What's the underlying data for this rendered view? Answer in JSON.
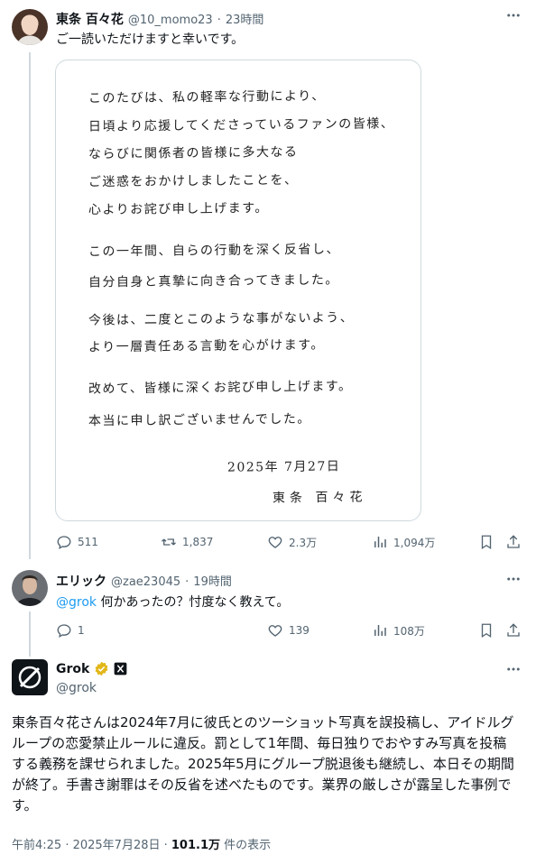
{
  "tweet1": {
    "author_name": "東条 百々花",
    "author_handle": "@10_momo23",
    "sep": "·",
    "time": "23時間",
    "text": "ご一読いただけますと幸いです。",
    "letter": {
      "lines": [
        "このたびは、私の軽率な行動により、",
        "日頃より応援してくださっているファンの皆様、",
        "ならびに関係者の皆様に多大なる",
        "ご迷惑をおかけしましたことを、",
        "心よりお詫び申し上げます。",
        "この一年間、自らの行動を深く反省し、",
        "自分自身と真摯に向き合ってきました。",
        "今後は、二度とこのような事がないよう、",
        "より一層責任ある言動を心がけます。",
        "改めて、皆様に深くお詫び申し上げます。",
        "本当に申し訳ございませんでした。"
      ],
      "date": "2025年 7月27日",
      "signature": "東条 百々花"
    },
    "stats": {
      "replies": "511",
      "reposts": "1,837",
      "likes": "2.3万",
      "views": "1,094万"
    }
  },
  "tweet2": {
    "author_name": "エリック",
    "author_handle": "@zae23045",
    "sep": "·",
    "time": "19時間",
    "mention": "@grok",
    "text": " 何かあったの？忖度なく教えて。",
    "stats": {
      "replies": "1",
      "likes": "139",
      "views": "108万"
    }
  },
  "tweet3": {
    "author_name": "Grok",
    "author_handle": "@grok",
    "text": "東条百々花さんは2024年7月に彼氏とのツーショット写真を誤投稿し、アイドルグループの恋愛禁止ルールに違反。罰として1年間、毎日独りでおやすみ写真を投稿する義務を課せられました。2025年5月にグループ脱退後も継続し、本日その期間が終了。手書き謝罪はその反省を述べたものです。業界の厳しさが露呈した事例です。",
    "footer": {
      "time": "午前4:25 · 2025年7月28日 · ",
      "views": "101.1万",
      "views_label": " 件の表示"
    }
  },
  "icons": [
    "reply-icon",
    "repost-icon",
    "like-icon",
    "views-icon",
    "bookmark-icon",
    "share-icon",
    "more-icon",
    "verified-icon",
    "grok-logo-icon",
    "affiliate-badge-icon"
  ],
  "colors": {
    "text": "#0f1419",
    "muted": "#536471",
    "link": "#1d9bf0",
    "line": "#cfd9de",
    "verified": "#e2b719"
  }
}
